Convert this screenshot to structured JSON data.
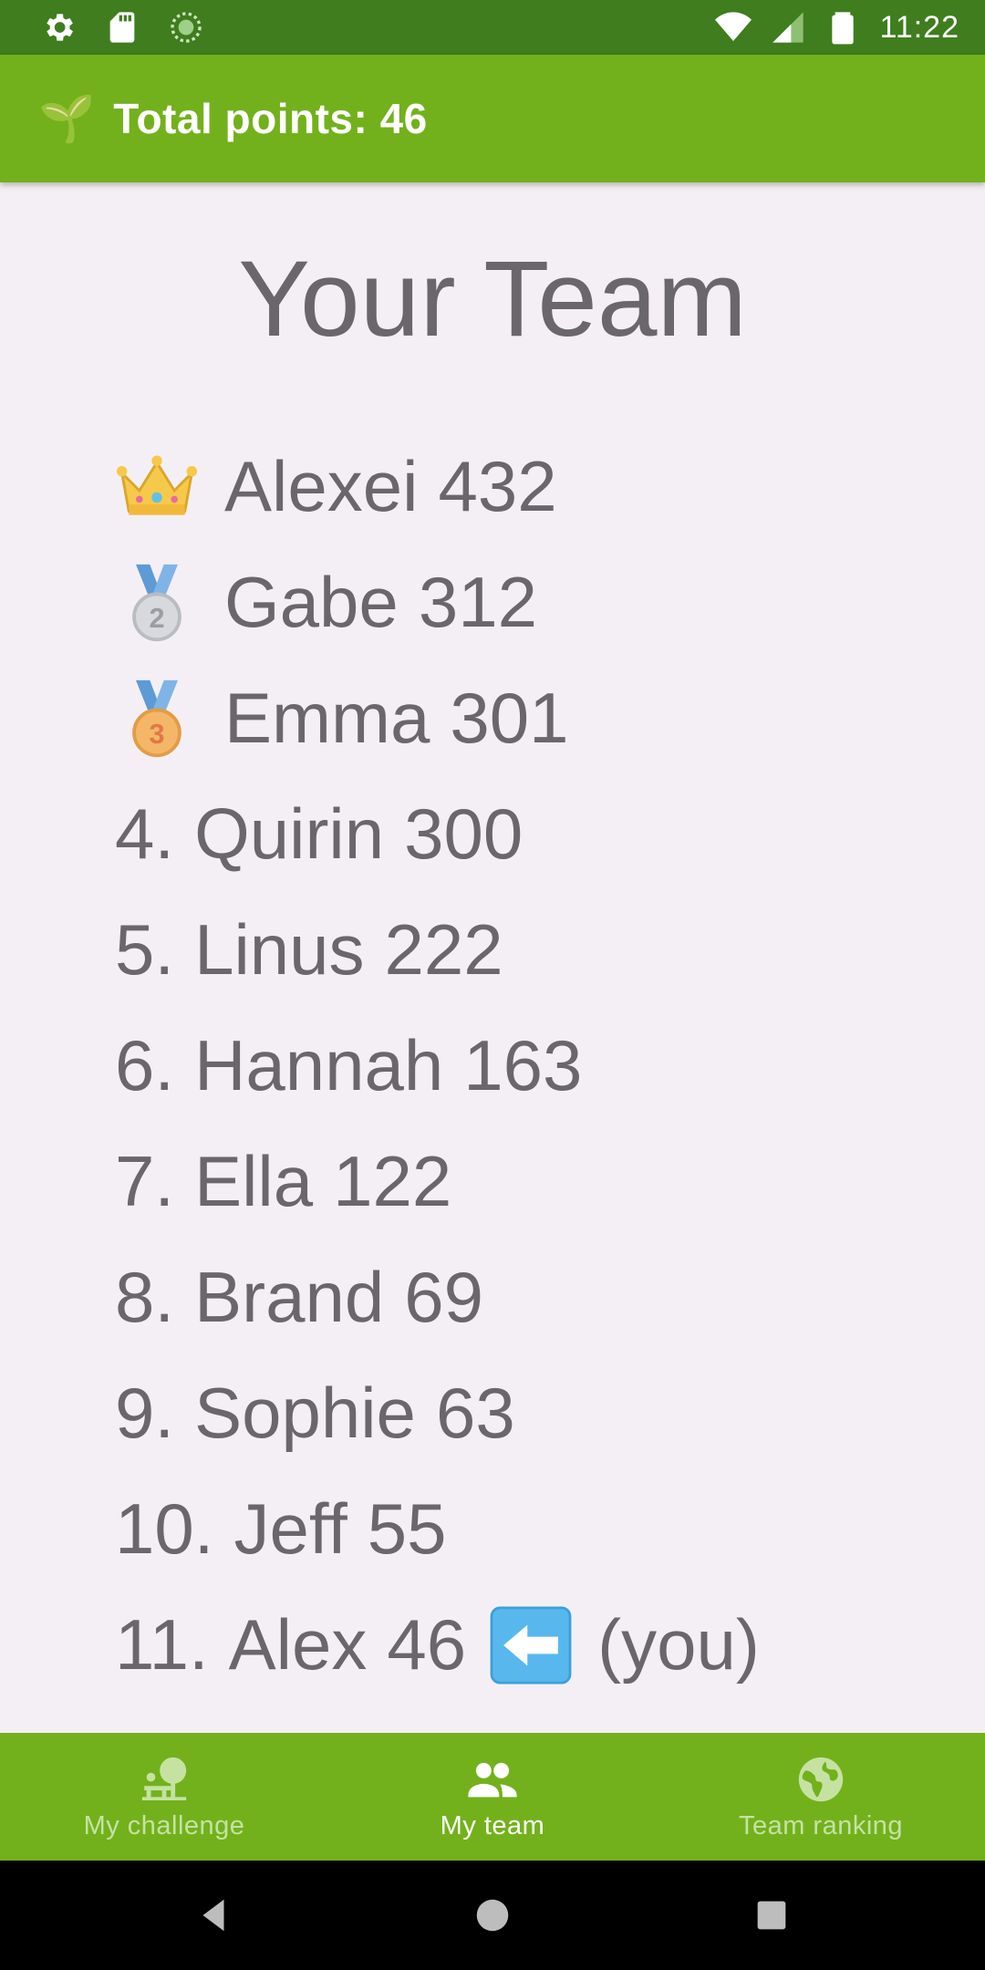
{
  "status_bar": {
    "time": "11:22",
    "icons": [
      "gear-icon",
      "sd-card-icon",
      "sync-icon",
      "wifi-icon",
      "cell-signal-icon",
      "battery-icon"
    ]
  },
  "app_bar": {
    "icon": "🌱",
    "title": "Total points: 46"
  },
  "main": {
    "title": "Your Team",
    "leaderboard": [
      {
        "rank_icon": "crown-icon",
        "name": "Alexei",
        "points": "432"
      },
      {
        "rank_icon": "silver-medal-icon",
        "name": "Gabe",
        "points": "312"
      },
      {
        "rank_icon": "bronze-medal-icon",
        "name": "Emma",
        "points": "301"
      },
      {
        "rank": "4.",
        "name": "Quirin",
        "points": "300"
      },
      {
        "rank": "5.",
        "name": "Linus",
        "points": "222"
      },
      {
        "rank": "6.",
        "name": "Hannah",
        "points": "163"
      },
      {
        "rank": "7.",
        "name": "Ella",
        "points": "122"
      },
      {
        "rank": "8.",
        "name": "Brand",
        "points": "69"
      },
      {
        "rank": "9.",
        "name": "Sophie",
        "points": "63"
      },
      {
        "rank": "10.",
        "name": "Jeff",
        "points": "55"
      },
      {
        "rank": "11.",
        "name": "Alex",
        "points": "46",
        "you_label": "(you)",
        "you_icon": "left-arrow-icon"
      }
    ]
  },
  "bottom_nav": {
    "items": [
      {
        "label": "My challenge",
        "icon": "tree-bench-icon",
        "active": false
      },
      {
        "label": "My team",
        "icon": "people-icon",
        "active": true
      },
      {
        "label": "Team ranking",
        "icon": "globe-icon",
        "active": false
      }
    ]
  },
  "colors": {
    "status_bar": "#3f7d1f",
    "app_bar": "#72b11c",
    "background": "#f4eff5",
    "text": "#6a676c",
    "nav_inactive": "#c6e2a2",
    "nav_active": "#ffffff"
  }
}
